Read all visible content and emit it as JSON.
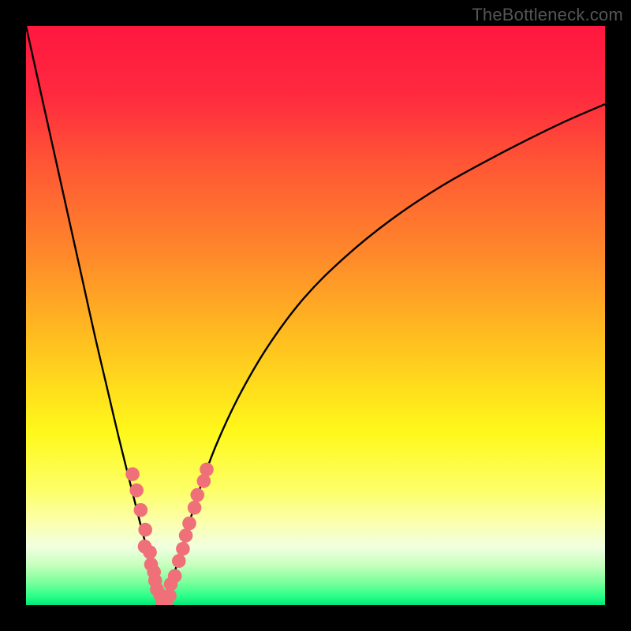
{
  "watermark": "TheBottleneck.com",
  "colors": {
    "black": "#000000",
    "curve_stroke": "#000000",
    "dot_fill": "#ef7079",
    "gradient_stops": [
      {
        "offset": 0.0,
        "color": "#ff173f"
      },
      {
        "offset": 0.12,
        "color": "#ff2a3f"
      },
      {
        "offset": 0.25,
        "color": "#ff5a34"
      },
      {
        "offset": 0.4,
        "color": "#ff8a2a"
      },
      {
        "offset": 0.55,
        "color": "#ffc21f"
      },
      {
        "offset": 0.7,
        "color": "#fff81a"
      },
      {
        "offset": 0.8,
        "color": "#fdff66"
      },
      {
        "offset": 0.86,
        "color": "#fbffb0"
      },
      {
        "offset": 0.9,
        "color": "#f0ffe0"
      },
      {
        "offset": 0.93,
        "color": "#c8ffbf"
      },
      {
        "offset": 0.96,
        "color": "#7dff9c"
      },
      {
        "offset": 0.985,
        "color": "#2bff88"
      },
      {
        "offset": 1.0,
        "color": "#00e878"
      }
    ]
  },
  "chart_data": {
    "type": "line",
    "title": "",
    "xlabel": "",
    "ylabel": "",
    "xlim": [
      0,
      100
    ],
    "ylim": [
      0,
      100
    ],
    "grid": false,
    "legend": false,
    "annotations": [
      "TheBottleneck.com"
    ],
    "series": [
      {
        "name": "left-curve",
        "x": [
          0,
          2,
          4,
          6,
          8,
          10,
          12,
          14,
          16,
          18,
          20,
          21,
          22,
          23,
          23.7
        ],
        "y": [
          100,
          91,
          82,
          73,
          64,
          55,
          46,
          37.5,
          29,
          21,
          13,
          9.5,
          6.2,
          3.2,
          0.5
        ]
      },
      {
        "name": "right-curve",
        "x": [
          23.7,
          25,
          26.5,
          28,
          30,
          33,
          37,
          42,
          48,
          55,
          63,
          72,
          82,
          92,
          100
        ],
        "y": [
          0.5,
          3.5,
          8.5,
          13.5,
          20,
          28,
          36.5,
          45,
          53,
          60,
          66.5,
          72.5,
          78,
          83,
          86.5
        ]
      }
    ],
    "markers": [
      {
        "name": "left-branch-dots",
        "points": [
          {
            "x": 18.4,
            "y": 22.6
          },
          {
            "x": 19.1,
            "y": 19.8
          },
          {
            "x": 19.8,
            "y": 16.4
          },
          {
            "x": 20.6,
            "y": 13.0
          },
          {
            "x": 20.5,
            "y": 10.1
          },
          {
            "x": 21.4,
            "y": 9.1
          },
          {
            "x": 21.6,
            "y": 7.0
          },
          {
            "x": 22.1,
            "y": 5.7
          },
          {
            "x": 22.3,
            "y": 4.2
          },
          {
            "x": 22.6,
            "y": 2.7
          },
          {
            "x": 23.2,
            "y": 1.7
          },
          {
            "x": 23.5,
            "y": 1.2
          }
        ]
      },
      {
        "name": "right-branch-dots",
        "points": [
          {
            "x": 23.6,
            "y": 0.4
          },
          {
            "x": 24.2,
            "y": 0.5
          },
          {
            "x": 24.8,
            "y": 1.6
          },
          {
            "x": 25.0,
            "y": 3.6
          },
          {
            "x": 25.7,
            "y": 5.0
          },
          {
            "x": 26.4,
            "y": 7.6
          },
          {
            "x": 27.1,
            "y": 9.7
          },
          {
            "x": 27.6,
            "y": 12.0
          },
          {
            "x": 28.2,
            "y": 14.1
          },
          {
            "x": 29.1,
            "y": 16.8
          },
          {
            "x": 29.6,
            "y": 19.0
          },
          {
            "x": 30.7,
            "y": 21.4
          },
          {
            "x": 31.2,
            "y": 23.4
          }
        ]
      }
    ]
  }
}
